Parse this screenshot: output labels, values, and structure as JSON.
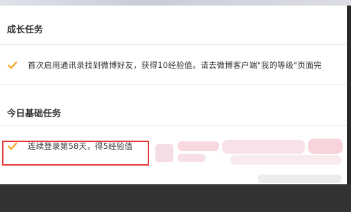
{
  "growth_tasks": {
    "title": "成长任务",
    "items": [
      {
        "text": "首次启用通讯录找到微博好友，获得10经验值。请去微博客户端\"我的等级\"页面完"
      }
    ]
  },
  "daily_tasks": {
    "title": "今日基础任务",
    "items": [
      {
        "text": "连续登录第58天，得5经验值"
      }
    ]
  },
  "colors": {
    "check": "#f5a623",
    "highlight": "#e53935",
    "text": "#333333"
  },
  "icons": {
    "check": "checkmark-icon"
  }
}
